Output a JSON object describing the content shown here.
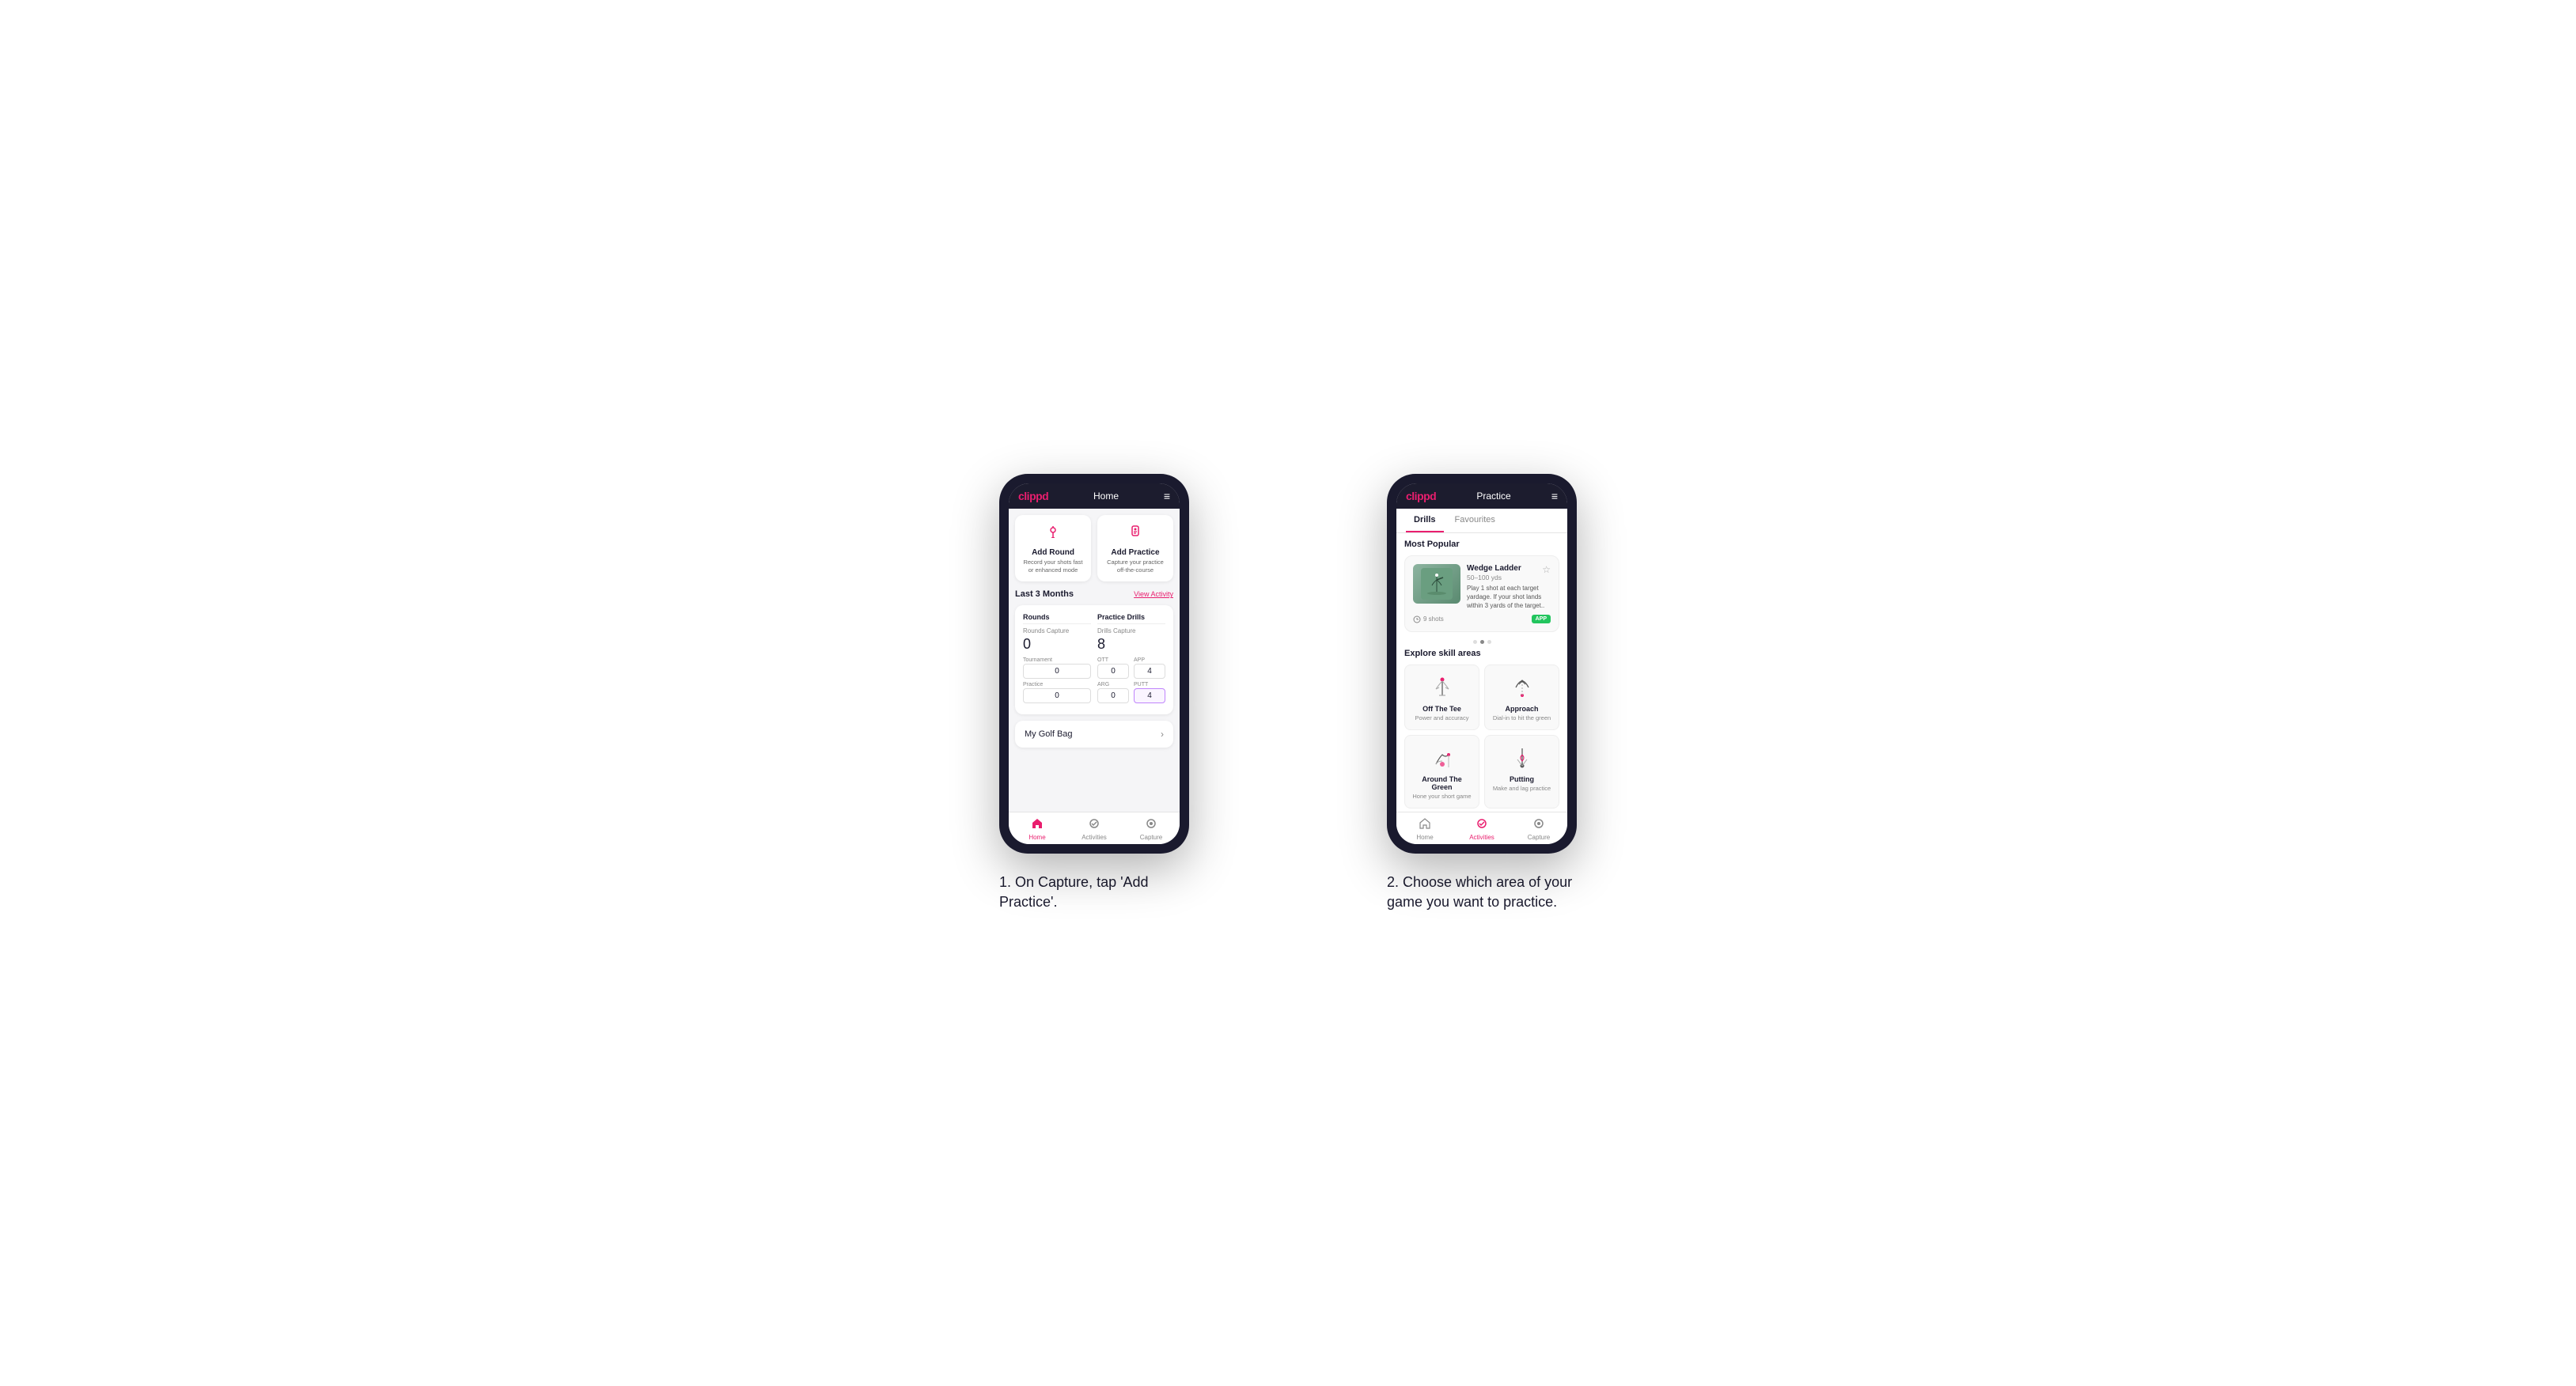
{
  "phone1": {
    "header": {
      "logo": "clippd",
      "title": "Home",
      "menu_icon": "≡"
    },
    "action_cards": [
      {
        "id": "add-round",
        "icon": "🏌️",
        "title": "Add Round",
        "description": "Record your shots fast or enhanced mode"
      },
      {
        "id": "add-practice",
        "icon": "📍",
        "title": "Add Practice",
        "description": "Capture your practice off-the-course"
      }
    ],
    "stats_section": {
      "title": "Last 3 Months",
      "view_activity": "View Activity",
      "rounds": {
        "title": "Rounds",
        "capture_label": "Rounds Capture",
        "capture_value": "0",
        "tournament_label": "Tournament",
        "tournament_value": "0",
        "practice_label": "Practice",
        "practice_value": "0"
      },
      "practice_drills": {
        "title": "Practice Drills",
        "capture_label": "Drills Capture",
        "capture_value": "8",
        "ott_label": "OTT",
        "ott_value": "0",
        "app_label": "APP",
        "app_value": "4",
        "arg_label": "ARG",
        "arg_value": "0",
        "putt_label": "PUTT",
        "putt_value": "4"
      }
    },
    "golf_bag": {
      "label": "My Golf Bag"
    },
    "nav": [
      {
        "id": "home",
        "label": "Home",
        "active": true
      },
      {
        "id": "activities",
        "label": "Activities",
        "active": false
      },
      {
        "id": "capture",
        "label": "Capture",
        "active": false
      }
    ]
  },
  "phone2": {
    "header": {
      "logo": "clippd",
      "title": "Practice",
      "menu_icon": "≡"
    },
    "tabs": [
      {
        "id": "drills",
        "label": "Drills",
        "active": true
      },
      {
        "id": "favourites",
        "label": "Favourites",
        "active": false
      }
    ],
    "most_popular": {
      "title": "Most Popular",
      "featured": {
        "title": "Wedge Ladder",
        "subtitle": "50–100 yds",
        "description": "Play 1 shot at each target yardage. If your shot lands within 3 yards of the target..",
        "shots": "9 shots",
        "badge": "APP"
      }
    },
    "explore": {
      "title": "Explore skill areas",
      "skills": [
        {
          "id": "off-the-tee",
          "name": "Off The Tee",
          "description": "Power and accuracy",
          "illustration": "tee"
        },
        {
          "id": "approach",
          "name": "Approach",
          "description": "Dial-in to hit the green",
          "illustration": "approach"
        },
        {
          "id": "around-the-green",
          "name": "Around The Green",
          "description": "Hone your short game",
          "illustration": "atg"
        },
        {
          "id": "putting",
          "name": "Putting",
          "description": "Make and lag practice",
          "illustration": "putt"
        }
      ]
    },
    "nav": [
      {
        "id": "home",
        "label": "Home",
        "active": false
      },
      {
        "id": "activities",
        "label": "Activities",
        "active": true
      },
      {
        "id": "capture",
        "label": "Capture",
        "active": false
      }
    ]
  },
  "captions": {
    "phone1": "1. On Capture, tap 'Add Practice'.",
    "phone2": "2. Choose which area of your game you want to practice."
  }
}
